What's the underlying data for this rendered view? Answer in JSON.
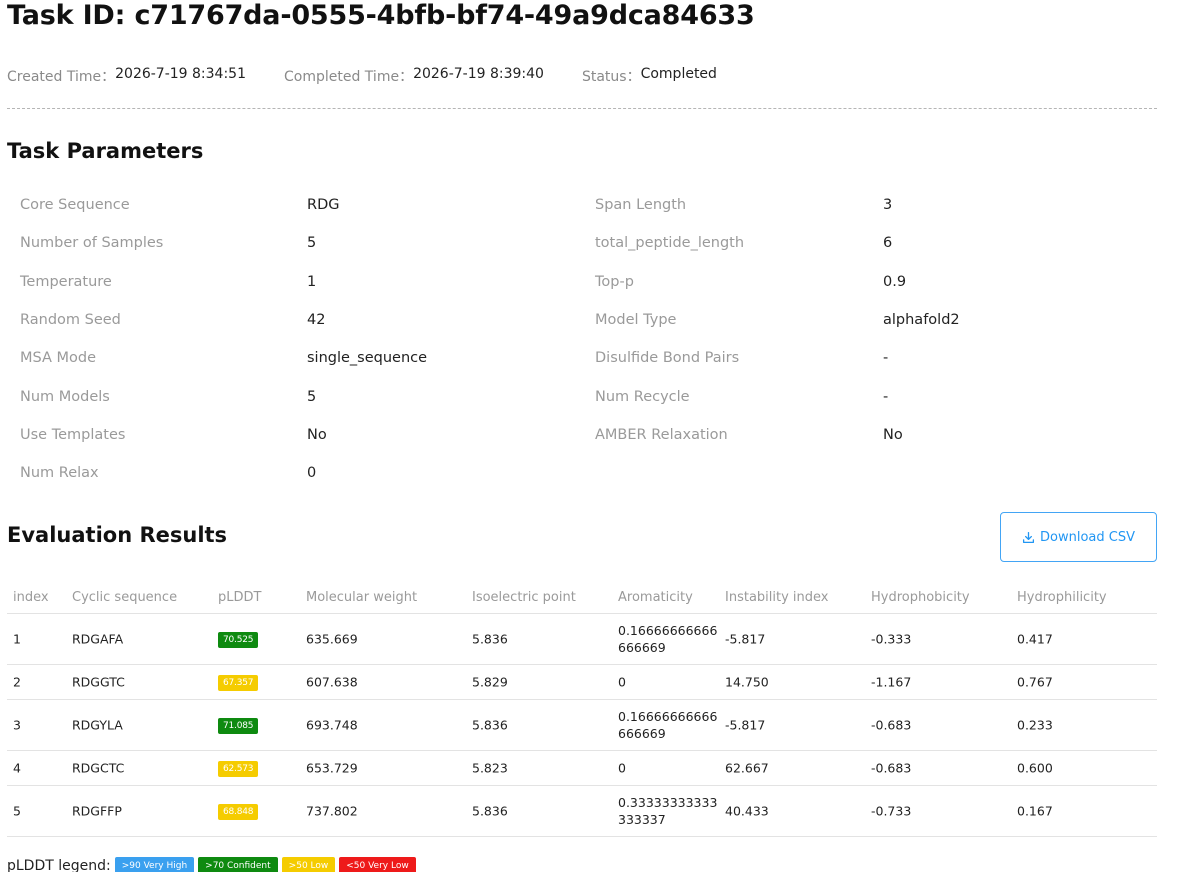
{
  "header": {
    "title": "Task ID: c71767da-0555-4bfb-bf74-49a9dca84633",
    "created_label": "Created Time：",
    "created_value": "2026-7-19 8:34:51",
    "completed_label": "Completed Time：",
    "completed_value": "2026-7-19 8:39:40",
    "status_label": "Status：",
    "status_value": "Completed"
  },
  "params": {
    "title": "Task Parameters",
    "left": [
      {
        "label": "Core Sequence",
        "value": "RDG"
      },
      {
        "label": "Number of Samples",
        "value": "5"
      },
      {
        "label": "Temperature",
        "value": "1"
      },
      {
        "label": "Random Seed",
        "value": "42"
      },
      {
        "label": "MSA Mode",
        "value": "single_sequence"
      },
      {
        "label": "Num Models",
        "value": "5"
      },
      {
        "label": "Use Templates",
        "value": "No"
      },
      {
        "label": "Num Relax",
        "value": "0"
      }
    ],
    "right": [
      {
        "label": "Span Length",
        "value": "3"
      },
      {
        "label": "total_peptide_length",
        "value": "6"
      },
      {
        "label": "Top-p",
        "value": "0.9"
      },
      {
        "label": "Model Type",
        "value": "alphafold2"
      },
      {
        "label": "Disulfide Bond Pairs",
        "value": "-"
      },
      {
        "label": "Num Recycle",
        "value": "-"
      },
      {
        "label": "AMBER Relaxation",
        "value": "No"
      }
    ]
  },
  "results": {
    "title": "Evaluation Results",
    "download_label": "Download CSV",
    "columns": [
      "index",
      "Cyclic sequence",
      "pLDDT",
      "Molecular weight",
      "Isoelectric point",
      "Aromaticity",
      "Instability index",
      "Hydrophobicity",
      "Hydrophilicity"
    ],
    "rows": [
      {
        "index": "1",
        "seq": "RDGAFA",
        "plddt": "70.525",
        "plddt_class": "b-conf",
        "mw": "635.669",
        "pi": "5.836",
        "arom": "0.16666666666666669",
        "instab": "-5.817",
        "hphob": "-0.333",
        "hphil": "0.417"
      },
      {
        "index": "2",
        "seq": "RDGGTC",
        "plddt": "67.357",
        "plddt_class": "b-low",
        "mw": "607.638",
        "pi": "5.829",
        "arom": "0",
        "instab": "14.750",
        "hphob": "-1.167",
        "hphil": "0.767"
      },
      {
        "index": "3",
        "seq": "RDGYLA",
        "plddt": "71.085",
        "plddt_class": "b-conf",
        "mw": "693.748",
        "pi": "5.836",
        "arom": "0.16666666666666669",
        "instab": "-5.817",
        "hphob": "-0.683",
        "hphil": "0.233"
      },
      {
        "index": "4",
        "seq": "RDGCTC",
        "plddt": "62.573",
        "plddt_class": "b-low",
        "mw": "653.729",
        "pi": "5.823",
        "arom": "0",
        "instab": "62.667",
        "hphob": "-0.683",
        "hphil": "0.600"
      },
      {
        "index": "5",
        "seq": "RDGFFP",
        "plddt": "68.848",
        "plddt_class": "b-low",
        "mw": "737.802",
        "pi": "5.836",
        "arom": "0.33333333333333337",
        "instab": "40.433",
        "hphob": "-0.733",
        "hphil": "0.167"
      }
    ]
  },
  "legend": {
    "label": "pLDDT legend:",
    "items": [
      {
        "text": ">90 Very High",
        "color": "#3aa0ef"
      },
      {
        "text": ">70 Confident",
        "color": "#0e8a10"
      },
      {
        "text": ">50 Low",
        "color": "#f5cc00"
      },
      {
        "text": "<50 Very Low",
        "color": "#ee1a1a"
      }
    ]
  }
}
